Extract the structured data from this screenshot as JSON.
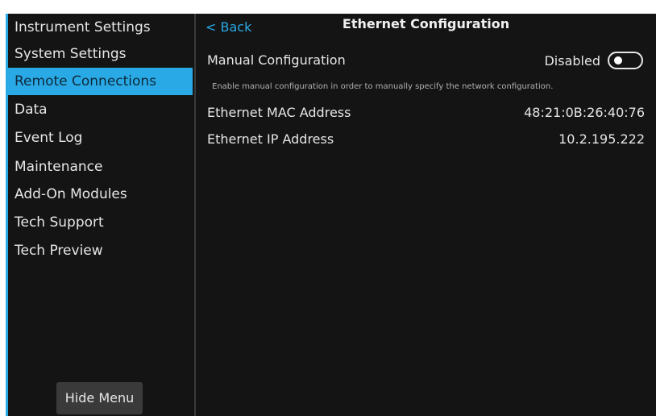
{
  "sidebar": {
    "items": [
      {
        "label": "Instrument Settings"
      },
      {
        "label": "System Settings"
      },
      {
        "label": "Remote Connections"
      },
      {
        "label": "Data"
      },
      {
        "label": "Event Log"
      },
      {
        "label": "Maintenance"
      },
      {
        "label": "Add-On Modules"
      },
      {
        "label": "Tech Support"
      },
      {
        "label": "Tech Preview"
      }
    ],
    "active_item": "Remote Connections",
    "hide_menu_label": "Hide Menu"
  },
  "header": {
    "back_label": "< Back",
    "title": "Ethernet Configuration"
  },
  "manual_config": {
    "label": "Manual Configuration",
    "status": "Disabled",
    "enabled": false,
    "hint": "Enable manual configuration in order to manually specify the network configuration."
  },
  "mac": {
    "label": "Ethernet MAC Address",
    "value": "48:21:0B:26:40:76"
  },
  "ip": {
    "label": "Ethernet IP Address",
    "value": "10.2.195.222"
  },
  "colors": {
    "accent": "#29a9e6",
    "background": "#141414",
    "button": "#3a3a3a",
    "text": "#e6e6e6"
  }
}
